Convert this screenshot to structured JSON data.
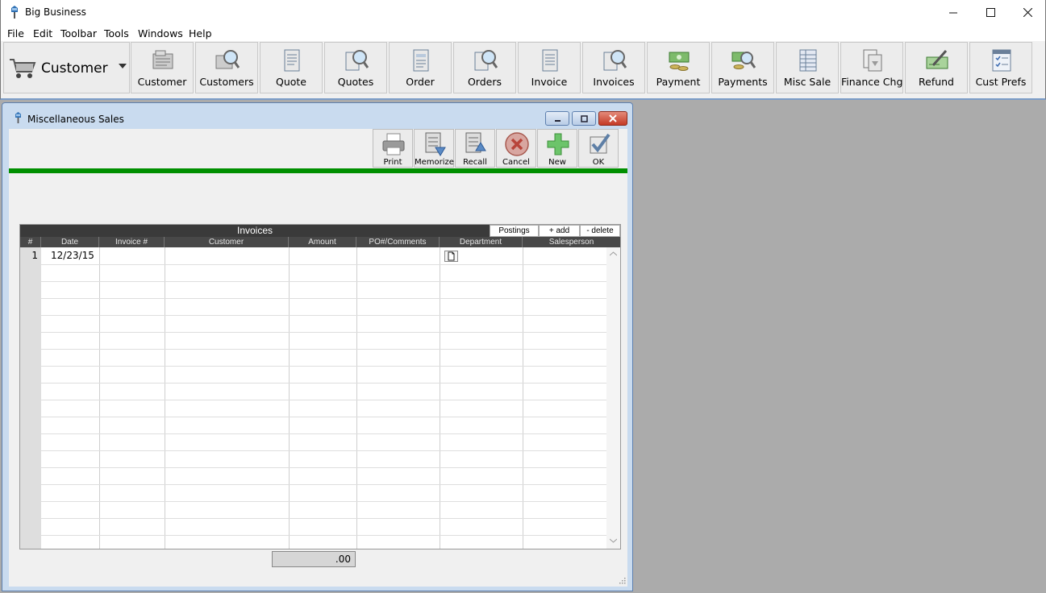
{
  "app": {
    "title": "Big Business"
  },
  "menu": [
    "File",
    "Edit",
    "Toolbar",
    "Tools",
    "Windows",
    "Help"
  ],
  "module": {
    "label": "Customer"
  },
  "toolbar": [
    {
      "label": "Customer",
      "icon": "customer-card-icon"
    },
    {
      "label": "Customers",
      "icon": "customers-search-icon"
    },
    {
      "label": "Quote",
      "icon": "quote-document-icon"
    },
    {
      "label": "Quotes",
      "icon": "quotes-search-icon"
    },
    {
      "label": "Order",
      "icon": "order-document-icon"
    },
    {
      "label": "Orders",
      "icon": "orders-search-icon"
    },
    {
      "label": "Invoice",
      "icon": "invoice-document-icon"
    },
    {
      "label": "Invoices",
      "icon": "invoices-search-icon"
    },
    {
      "label": "Payment",
      "icon": "payment-money-icon"
    },
    {
      "label": "Payments",
      "icon": "payments-search-icon"
    },
    {
      "label": "Misc Sale",
      "icon": "misc-sale-icon"
    },
    {
      "label": "Finance Chg",
      "icon": "finance-charge-icon"
    },
    {
      "label": "Refund",
      "icon": "refund-check-icon"
    },
    {
      "label": "Cust Prefs",
      "icon": "cust-prefs-checklist-icon"
    }
  ],
  "window": {
    "title": "Miscellaneous Sales",
    "actions": [
      {
        "label": "Print",
        "icon": "printer-icon"
      },
      {
        "label": "Memorize",
        "icon": "memorize-icon"
      },
      {
        "label": "Recall",
        "icon": "recall-icon"
      },
      {
        "label": "Cancel",
        "icon": "cancel-icon"
      },
      {
        "label": "New",
        "icon": "plus-icon"
      },
      {
        "label": "OK",
        "icon": "ok-check-icon"
      }
    ],
    "status_color": "#008f00"
  },
  "grid": {
    "caption": "Invoices",
    "tabs": [
      "Postings",
      "+ add",
      "- delete"
    ],
    "columns": [
      "#",
      "Date",
      "Invoice #",
      "Customer",
      "Amount",
      "PO#/Comments",
      "Department",
      "Salesperson"
    ],
    "rows": [
      {
        "num": "1",
        "date": "12/23/15"
      }
    ],
    "total": ".00"
  }
}
